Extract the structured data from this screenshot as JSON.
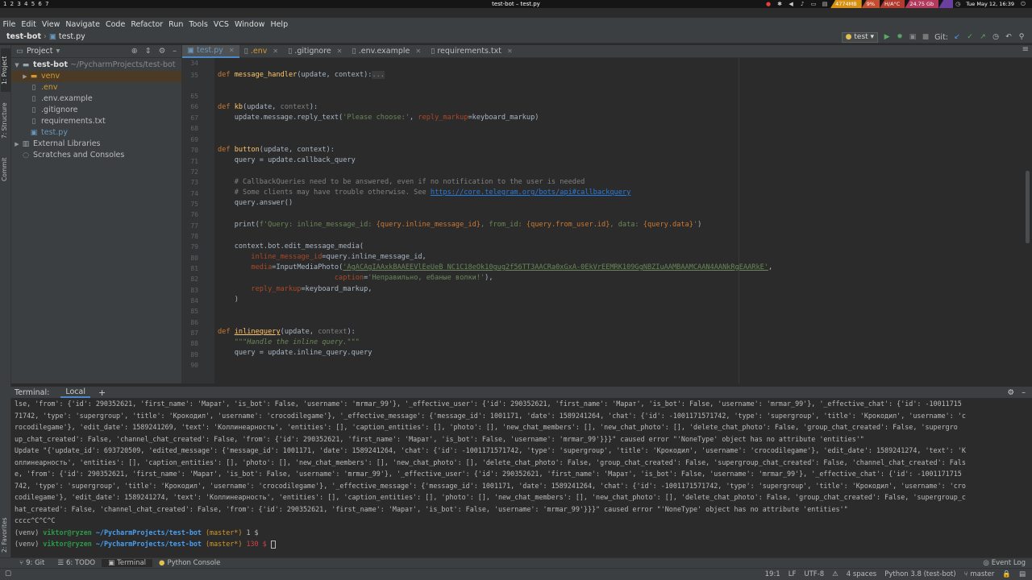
{
  "system_bar": {
    "workspaces": "1 2 3 4 5 6 7",
    "window_title": "test-bot – test.py",
    "tray": [
      {
        "text": "4774MB",
        "color": "#d89013"
      },
      {
        "text": "9%",
        "color": "#c44d30"
      },
      {
        "text": "H/A°C",
        "color": "#b23a2e"
      },
      {
        "text": "24.75 Gb",
        "color": "#b23a5e"
      },
      {
        "text": "",
        "color": "#6b3fa0"
      }
    ],
    "clock": "Tue May 12, 16:39"
  },
  "menu": [
    "File",
    "Edit",
    "View",
    "Navigate",
    "Code",
    "Refactor",
    "Run",
    "Tools",
    "VCS",
    "Window",
    "Help"
  ],
  "breadcrumb": {
    "project": "test-bot",
    "file": "test.py"
  },
  "toolbar": {
    "run_config": "test",
    "git_label": "Git:"
  },
  "left_tabs": {
    "project": "1: Project",
    "structure": "7: Structure",
    "commit": "Commit",
    "favorites": "2: Favorites"
  },
  "project_panel": {
    "title": "Project",
    "root_name": "test-bot",
    "root_path": "~/PycharmProjects/test-bot",
    "items": [
      {
        "name": "venv",
        "color": "#d19a2b",
        "icon": "folder-icon",
        "level": 1
      },
      {
        "name": ".env",
        "color": "#d19a2b",
        "icon": "file-icon",
        "level": 1
      },
      {
        "name": ".env.example",
        "color": "#bbbbbb",
        "icon": "file-icon",
        "level": 1
      },
      {
        "name": ".gitignore",
        "color": "#bbbbbb",
        "icon": "file-icon",
        "level": 1
      },
      {
        "name": "requirements.txt",
        "color": "#bbbbbb",
        "icon": "file-icon",
        "level": 1
      },
      {
        "name": "test.py",
        "color": "#6897bb",
        "icon": "python-file-icon",
        "level": 1
      }
    ],
    "external": "External Libraries",
    "scratches": "Scratches and Consoles"
  },
  "tabs": [
    {
      "label": "test.py",
      "active": true
    },
    {
      "label": ".env",
      "active": false
    },
    {
      "label": ".gitignore",
      "active": false
    },
    {
      "label": ".env.example",
      "active": false
    },
    {
      "label": "requirements.txt",
      "active": false
    }
  ],
  "line_numbers": [
    "34",
    "35",
    "65",
    "66",
    "67",
    "68",
    "69",
    "70",
    "71",
    "72",
    "73",
    "74",
    "75",
    "76",
    "77",
    "78",
    "79",
    "80",
    "81",
    "82",
    "83",
    "84",
    "85",
    "86",
    "87",
    "88",
    "89",
    "90"
  ],
  "code": {
    "l35": {
      "kw": "def",
      "fn": "message_handler",
      "args": "(update, context):",
      "fold": "..."
    },
    "l66": {
      "kw": "def",
      "fn": "kb",
      "a": "(update, ",
      "p": "context",
      "b": "):"
    },
    "l67": {
      "a": "update.message.reply_text(",
      "s": "'Please choose:'",
      "b": ", ",
      "n": "reply_markup",
      "c": "=keyboard_markup)"
    },
    "l70": {
      "kw": "def",
      "fn": "button",
      "args": "(update, context):"
    },
    "l71": {
      "text": "query = update.callback_query"
    },
    "l73": {
      "text": "# CallbackQueries need to be answered, even if no notification to the user is needed"
    },
    "l74": {
      "pre": "# Some clients may have trouble otherwise. See ",
      "link": "https://core.telegram.org/bots/api#callbackquery"
    },
    "l75": {
      "text": "query.answer()"
    },
    "l77": {
      "a": "print(",
      "s1": "f'Query: inline_message_id: ",
      "e1": "{query.inline_message_id}",
      "s2": ", from_id: ",
      "e2": "{query.from_user.id}",
      "s3": ", data: ",
      "e3": "{query.data}",
      "s4": "'",
      "b": ")"
    },
    "l79": {
      "text": "context.bot.edit_message_media("
    },
    "l80": {
      "n": "inline_message_id",
      "b": "=query.inline_message_id,"
    },
    "l81": {
      "n": "media",
      "b": "=InputMediaPhoto(",
      "s": "'AgACAgIAAxkBAAEEVlEeUeB_NC1C18eOk10gug2f56TT3AACRa0xGxA-0EkVrEEMRK109GgNBZIuAAMBAAMCAAN4AANkRgEAARkE'",
      "c": ","
    },
    "l82": {
      "n": "caption",
      "b": "=",
      "s": "'Неправильно, ебаные волки!'",
      "c": "),"
    },
    "l83": {
      "n": "reply_markup",
      "b": "=keyboard_markup,"
    },
    "l84": {
      "text": ")"
    },
    "l87": {
      "kw": "def",
      "fn": "inlinequery",
      "a": "(update, ",
      "p": "context",
      "b": "):"
    },
    "l88": {
      "text": "\"\"\"Handle the inline query.\"\"\""
    },
    "l89": {
      "a": "query = update.inline_query.query"
    }
  },
  "terminal": {
    "title": "Terminal:",
    "tab": "Local",
    "lines": [
      "lse, 'from': {'id': 290352621, 'first_name': 'Марат', 'is_bot': False, 'username': 'mrmar_99'}, '_effective_user': {'id': 290352621, 'first_name': 'Марат', 'is_bot': False, 'username': 'mrmar_99'}, '_effective_chat': {'id': -10011715",
      "71742, 'type': 'supergroup', 'title': 'Крокодил', 'username': 'crocodilegame'}, '_effective_message': {'message_id': 1001171, 'date': 1589241264, 'chat': {'id': -1001171571742, 'type': 'supergroup', 'title': 'Крокодил', 'username': 'c",
      "rocodilegame'}, 'edit_date': 1589241269, 'text': 'Коллинеарность', 'entities': [], 'caption_entities': [], 'photo': [], 'new_chat_members': [], 'new_chat_photo': [], 'delete_chat_photo': False, 'group_chat_created': False, 'supergro",
      "up_chat_created': False, 'channel_chat_created': False, 'from': {'id': 290352621, 'first_name': 'Марат', 'is_bot': False, 'username': 'mrmar_99'}}}\" caused error \"'NoneType' object has no attribute 'entities'\"",
      "Update \"{'update_id': 693720509, 'edited_message': {'message_id': 1001171, 'date': 1589241264, 'chat': {'id': -1001171571742, 'type': 'supergroup', 'title': 'Крокодил', 'username': 'crocodilegame'}, 'edit_date': 1589241274, 'text': 'К",
      "оллинеарность', 'entities': [], 'caption_entities': [], 'photo': [], 'new_chat_members': [], 'new_chat_photo': [], 'delete_chat_photo': False, 'group_chat_created': False, 'supergroup_chat_created': False, 'channel_chat_created': Fals",
      "e, 'from': {'id': 290352621, 'first_name': 'Марат', 'is_bot': False, 'username': 'mrmar_99'}, '_effective_user': {'id': 290352621, 'first_name': 'Марат', 'is_bot': False, 'username': 'mrmar_99'}, '_effective_chat': {'id': -1001171715",
      "742, 'type': 'supergroup', 'title': 'Крокодил', 'username': 'crocodilegame'}, '_effective_message': {'message_id': 1001171, 'date': 1589241264, 'chat': {'id': -1001171571742, 'type': 'supergroup', 'title': 'Крокодил', 'username': 'cro",
      "codilegame'}, 'edit_date': 1589241274, 'text': 'Коллинеарность', 'entities': [], 'caption_entities': [], 'photo': [], 'new_chat_members': [], 'new_chat_photo': [], 'delete_chat_photo': False, 'group_chat_created': False, 'supergroup_c",
      "hat_created': False, 'channel_chat_created': False, 'from': {'id': 290352621, 'first_name': 'Марат', 'is_bot': False, 'username': 'mrmar_99'}}}\" caused error \"'NoneType' object has no attribute 'entities'\"",
      "cccc^C^C^C"
    ],
    "prompt1": {
      "venv": "(venv) ",
      "user": "viktor@ryzen ",
      "dir": "~/PycharmProjects/test-bot",
      "branch": " (master*) ",
      "code": "1 $"
    },
    "prompt2": {
      "venv": "(venv) ",
      "user": "viktor@ryzen ",
      "dir": "~/PycharmProjects/test-bot",
      "branch": " (master*) ",
      "code": "130 $ "
    }
  },
  "bottom_tabs": [
    "9: Git",
    "6: TODO",
    "Terminal",
    "Python Console"
  ],
  "event_log": "Event Log",
  "status": {
    "position": "19:1",
    "line_sep": "LF",
    "encoding": "UTF-8",
    "indent": "4 spaces",
    "interpreter": "Python 3.8 (test-bot)",
    "branch": "master"
  }
}
